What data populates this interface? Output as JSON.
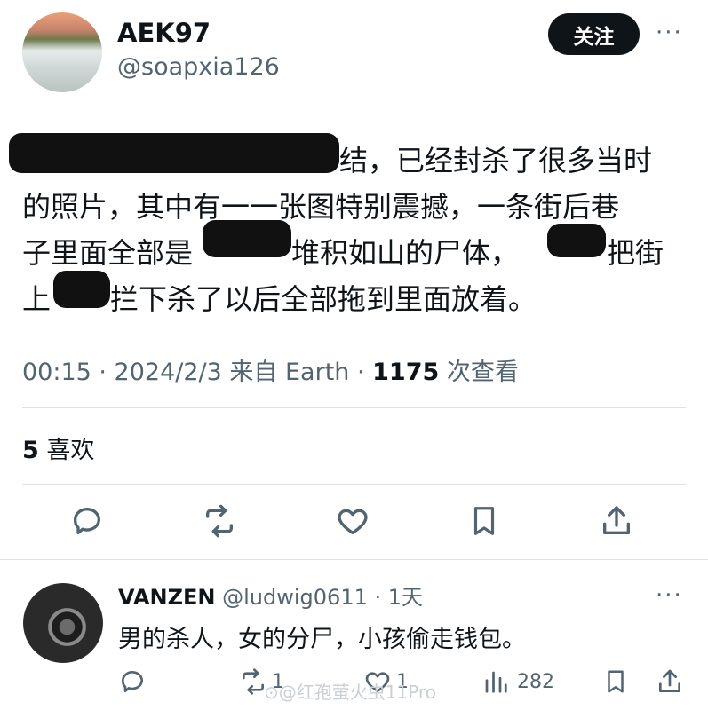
{
  "tweet": {
    "display_name": "AEK97",
    "handle": "@soapxia126",
    "follow_label": "关注",
    "more_label": "···",
    "body_lines": [
      "结，已经封杀了很多当时",
      "的照片，其中有一一张图特别震撼，一条街后巷",
      "子里面全部是",
      "堆积如山的尸体，",
      "把街",
      "上",
      "拦下杀了以后全部拖到里面放着。"
    ],
    "meta_time": "00:15 · 2024/2/3 来自 Earth · ",
    "meta_views_count": "1175",
    "meta_views_label": " 次查看",
    "likes_count": "5",
    "likes_label": " 喜欢"
  },
  "reply": {
    "display_name": "VANZEN",
    "handle": " @ludwig0611 · 1天",
    "text": "男的杀人，女的分尸，小孩偷走钱包。",
    "retweet_count": "1",
    "like_count": "1",
    "views_count": "282"
  },
  "watermark": "⊙@红孢萤火虫11Pro",
  "icons": [
    "reply-icon",
    "retweet-icon",
    "like-icon",
    "bookmark-icon",
    "share-icon",
    "views-icon"
  ],
  "colors": {
    "text": "#0f1419",
    "secondary": "#536471",
    "follow_bg": "#0f1419",
    "divider": "#dfe3e6"
  }
}
